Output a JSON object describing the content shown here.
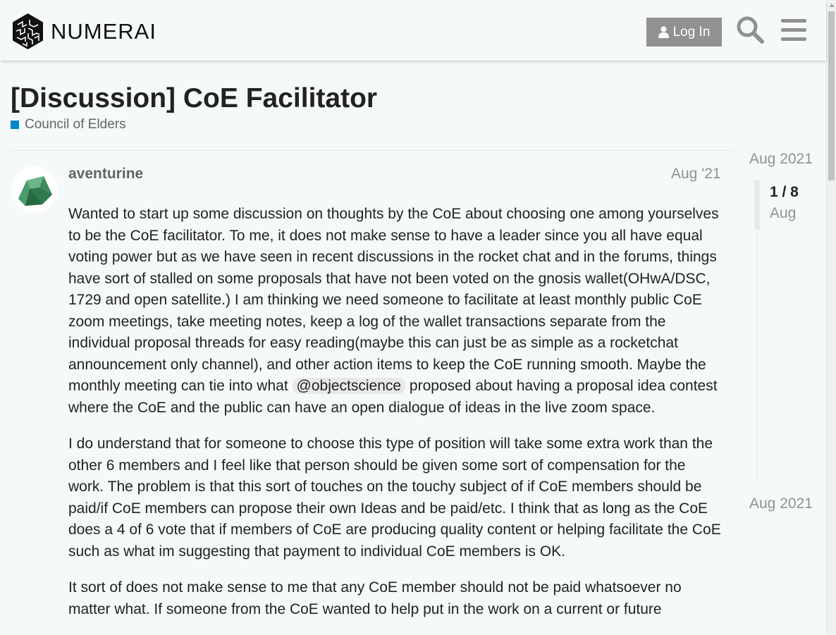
{
  "header": {
    "logo_text": "NUMERAI",
    "login_label": "Log In",
    "icons": [
      "user-icon",
      "search-icon",
      "hamburger-menu-icon"
    ]
  },
  "topic": {
    "title": "[Discussion] CoE Facilitator",
    "category": "Council of Elders",
    "category_color": "#0088cc"
  },
  "post": {
    "username": "aventurine",
    "date": "Aug '21",
    "p1_before": "Wanted to start up some discussion on thoughts by the CoE about choosing one among yourselves to be the CoE facilitator. To me, it does not make sense to have a leader since you all have equal voting power but as we have seen in recent discussions in the rocket chat and in the forums, things have sort of stalled on some proposals that have not been voted on the gnosis wallet(OHwA/DSC, 1729 and open satellite.) I am thinking we need someone to facilitate at least monthly public CoE zoom meetings, take meeting notes, keep a log of the wallet transactions separate from the individual proposal threads for easy reading(maybe this can just be as simple as a rocketchat announcement only channel), and other action items to keep the CoE running smooth. Maybe the monthly meeting can tie into what ",
    "mention": "@objectscience",
    "p1_after": " proposed about having a proposal idea contest where the CoE and the public can have an open dialogue of ideas in the live zoom space.",
    "p2": "I do understand that for someone to choose this type of position will take some extra work than the other 6 members and I feel like that person should be given some sort of compensation for the work. The problem is that this sort of touches on the touchy subject of if CoE members should be paid/if CoE members can propose their own Ideas and be paid/etc. I think that as long as the CoE does a 4 of 6 vote that if members of CoE are producing quality content or helping facilitate the CoE such as what im suggesting that payment to individual CoE members is OK.",
    "p3": "It sort of does not make sense to me that any CoE member should not be paid whatsoever no matter what. If someone from the CoE wanted to help put in the work on a current or future"
  },
  "timeline": {
    "start": "Aug 2021",
    "position": "1 / 8",
    "position_date": "Aug",
    "end": "Aug 2021"
  },
  "colors": {
    "background": "#f5f9fa",
    "login_button": "#919191",
    "muted_text": "#919191",
    "mention_bg": "#e9e9e9"
  }
}
